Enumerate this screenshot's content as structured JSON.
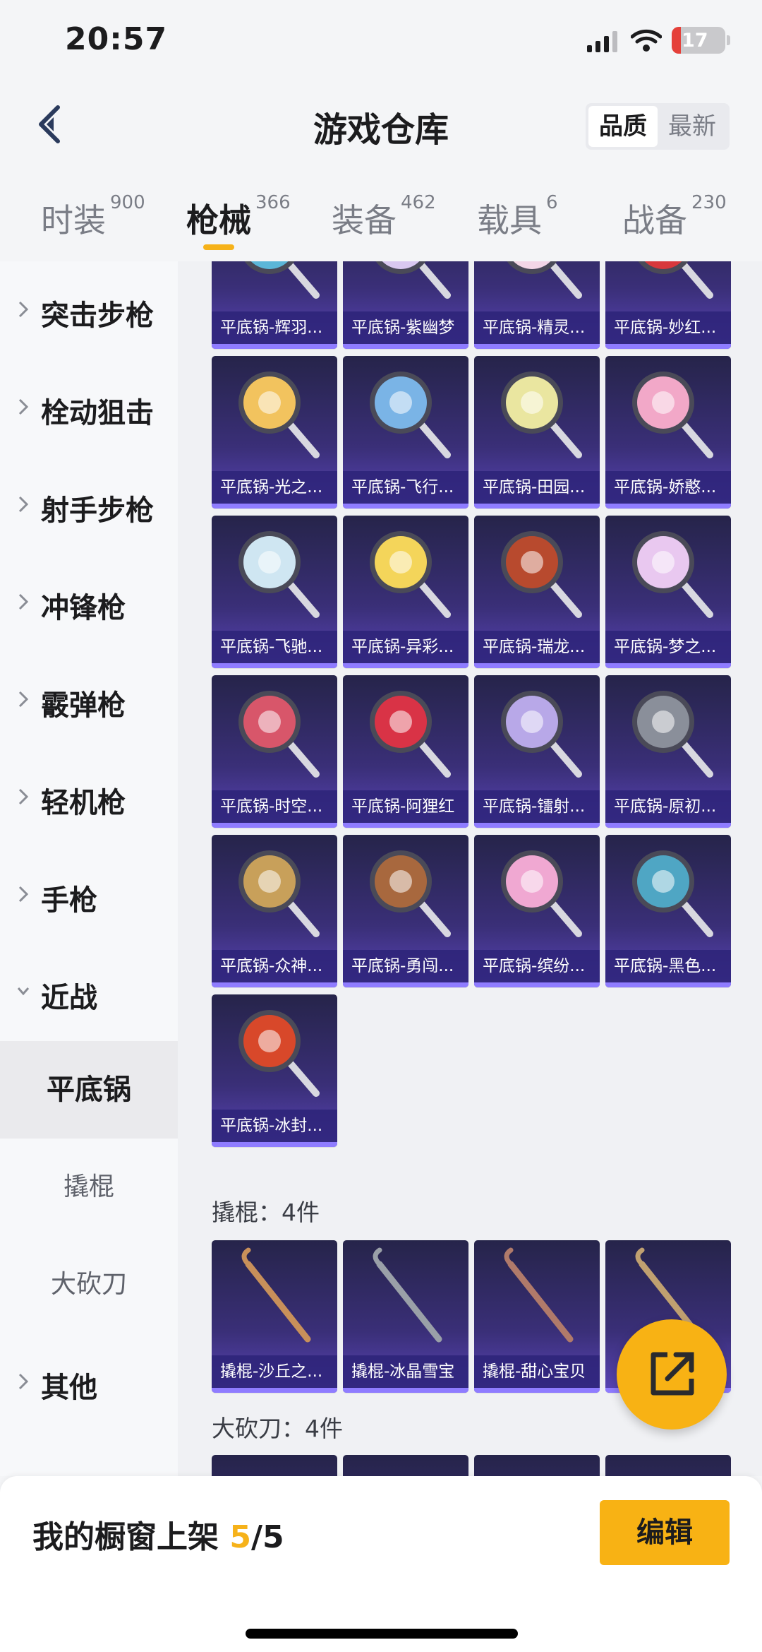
{
  "status_bar": {
    "time": "20:57",
    "battery": "17",
    "battery_level": 0.17
  },
  "header": {
    "title": "游戏仓库",
    "sort_options": [
      "品质",
      "最新"
    ],
    "sort_selected": "品质"
  },
  "tabs": [
    {
      "label": "时装",
      "count": "900"
    },
    {
      "label": "枪械",
      "count": "366"
    },
    {
      "label": "装备",
      "count": "462"
    },
    {
      "label": "载具",
      "count": "6"
    },
    {
      "label": "战备",
      "count": "230"
    }
  ],
  "active_tab": "枪械",
  "sidebar": {
    "categories": [
      "突击步枪",
      "栓动狙击",
      "射手步枪",
      "冲锋枪",
      "霰弹枪",
      "轻机枪",
      "手枪",
      "近战"
    ],
    "subcategories": [
      "平底锅",
      "撬棍",
      "大砍刀"
    ],
    "active_subcategory": "平底锅",
    "other": "其他"
  },
  "pans": [
    {
      "label": "平底锅-辉羽...",
      "color": "#5bb6d8"
    },
    {
      "label": "平底锅-紫幽梦",
      "color": "#d9c8f0"
    },
    {
      "label": "平底锅-精灵...",
      "color": "#f3d6e6"
    },
    {
      "label": "平底锅-妙红...",
      "color": "#d8383c"
    },
    {
      "label": "平底锅-光之...",
      "color": "#f2c35e"
    },
    {
      "label": "平底锅-飞行...",
      "color": "#7ab4e6"
    },
    {
      "label": "平底锅-田园...",
      "color": "#eae6a0"
    },
    {
      "label": "平底锅-娇憨...",
      "color": "#f2a8c8"
    },
    {
      "label": "平底锅-飞驰...",
      "color": "#cfe6f2"
    },
    {
      "label": "平底锅-异彩...",
      "color": "#f4d55a"
    },
    {
      "label": "平底锅-瑞龙...",
      "color": "#b84a2e"
    },
    {
      "label": "平底锅-梦之...",
      "color": "#e9c8f0"
    },
    {
      "label": "平底锅-时空...",
      "color": "#d8566a"
    },
    {
      "label": "平底锅-阿狸红",
      "color": "#d93346"
    },
    {
      "label": "平底锅-镭射...",
      "color": "#b8a8e8"
    },
    {
      "label": "平底锅-原初...",
      "color": "#8a8f9a"
    },
    {
      "label": "平底锅-众神...",
      "color": "#c8a05a"
    },
    {
      "label": "平底锅-勇闯...",
      "color": "#a8683e"
    },
    {
      "label": "平底锅-缤纷...",
      "color": "#f0a8d2"
    },
    {
      "label": "平底锅-黑色...",
      "color": "#4fa6c4"
    },
    {
      "label": "平底锅-冰封...",
      "color": "#d8482a"
    }
  ],
  "crowbar_section": {
    "title": "撬棍：4件",
    "items": [
      {
        "label": "撬棍-沙丘之...",
        "color": "#c8905a"
      },
      {
        "label": "撬棍-冰晶雪宝",
        "color": "#9aa0a8"
      },
      {
        "label": "撬棍-甜心宝贝",
        "color": "#b07a6a"
      },
      {
        "label": "",
        "color": "#c0a070"
      }
    ]
  },
  "machete_section": {
    "title": "大砍刀：4件"
  },
  "bottom_bar": {
    "shelf_label": "我的橱窗上架",
    "shelf_count": "5",
    "shelf_total": "/5",
    "edit_label": "编辑"
  }
}
